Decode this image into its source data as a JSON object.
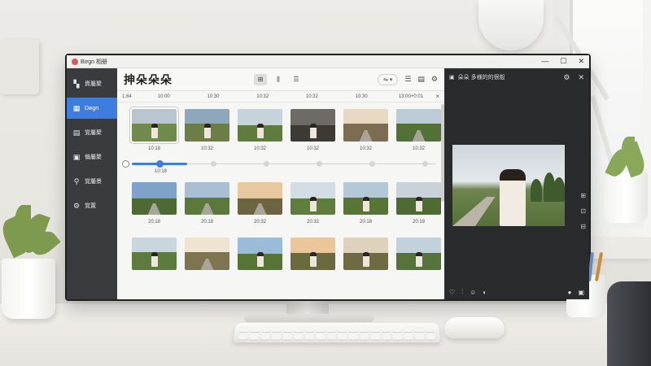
{
  "app": {
    "window_title": "Bơgn 相册",
    "window_controls": [
      "—",
      "☐",
      "✕"
    ]
  },
  "sidebar": {
    "items": [
      {
        "label": "資屬聚",
        "icon": "photos-icon"
      },
      {
        "label": "Døgn",
        "icon": "grid-icon",
        "active": true
      },
      {
        "label": "覚屬聚",
        "icon": "album-icon"
      },
      {
        "label": "偏屬聚",
        "icon": "image-icon"
      },
      {
        "label": "覚屬景",
        "icon": "search-icon"
      },
      {
        "label": "覚置",
        "icon": "gear-icon"
      }
    ]
  },
  "main": {
    "title": "抻朵朵朵",
    "view_buttons": [
      "⊞",
      "⫼",
      "☰"
    ],
    "sort_label": "⇋",
    "timeline": {
      "first": "1.64",
      "ticks": [
        "10:00",
        "10:30",
        "10:32",
        "10:32",
        "10:30",
        "13:00+0:01"
      ],
      "close": "×"
    },
    "rows": [
      {
        "captions": [
          "10:18",
          "10:32",
          "10:32",
          "10:32",
          "10:32",
          "10:32"
        ]
      },
      {
        "captions": [
          "20:18",
          "20:18",
          "20:32",
          "20:32",
          "20:18",
          "20:19"
        ]
      },
      {
        "captions": [
          "",
          "",
          "",
          "",
          "",
          ""
        ]
      }
    ],
    "slider_caption": "10:18"
  },
  "preview": {
    "title": "朵朵 多様的的很般",
    "footer_left": [
      "♡",
      "⫶",
      "☺",
      "◐"
    ],
    "footer_right": [
      "●",
      "▣"
    ]
  },
  "colors": {
    "accent": "#3d7de0",
    "sidebar_bg": "#3a3b3e",
    "preview_bg": "#2a2b2d"
  }
}
